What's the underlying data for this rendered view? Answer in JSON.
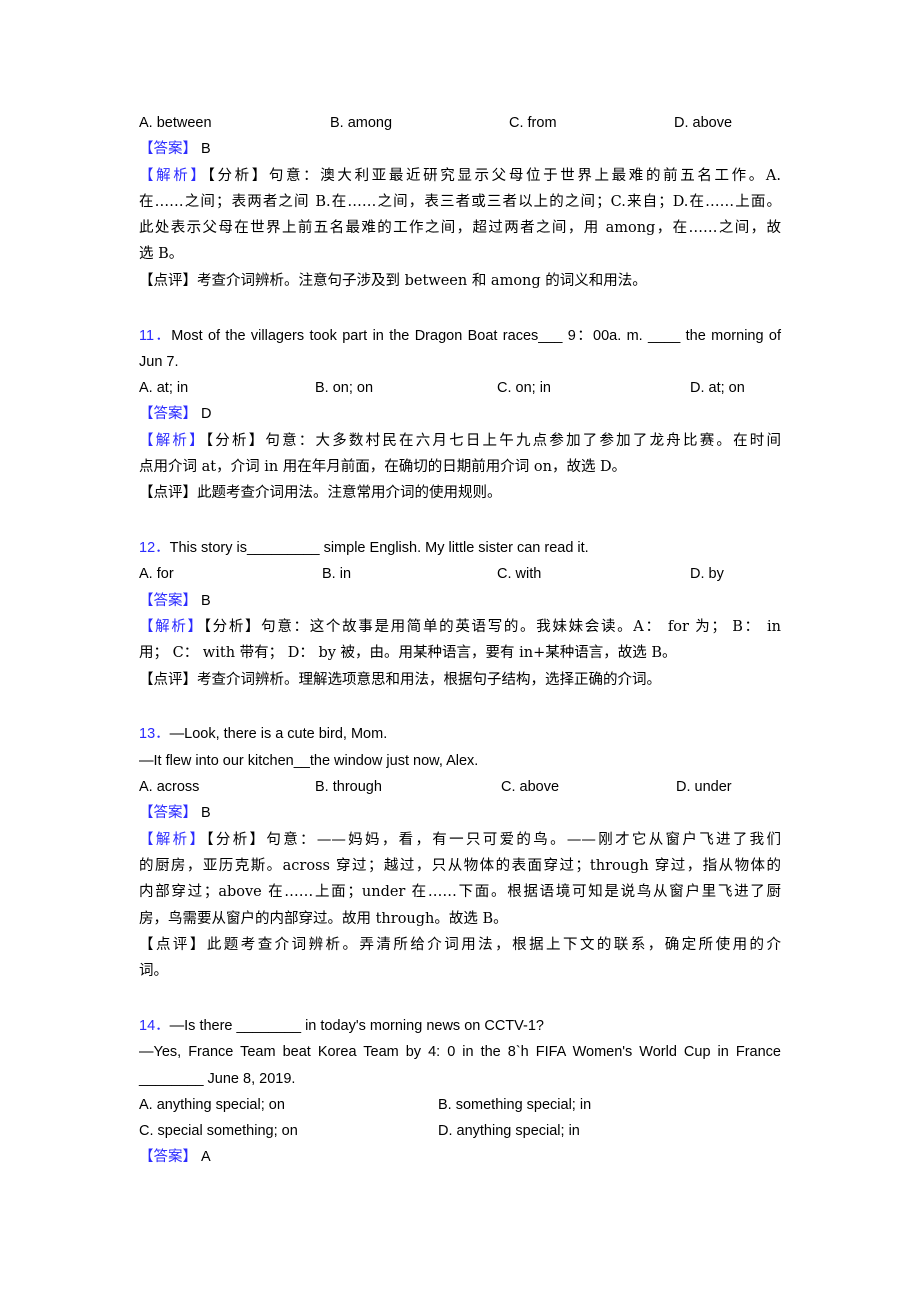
{
  "q10": {
    "options": [
      "A. between",
      "B. among",
      "C. from",
      "D. above"
    ],
    "answer_label": "【答案】",
    "answer": "B",
    "analysis_label": "【解析】",
    "analysis_lines": [
      "【分析】句意：澳大利亚最近研究显示父母位于世界上最难的前五名工作。A.",
      "在……之间；表两者之间 B.在……之间，表三者或三者以上的之间；C.来自；D.在……上面。",
      "此处表示父母在世界上前五名最难的工作之间，超过两者之间，用 among，在……之间，故",
      "选 B。"
    ],
    "comment": "【点评】考查介词辨析。注意句子涉及到 between 和 among 的词义和用法。"
  },
  "q11": {
    "number": "11．",
    "stem_lines": [
      "Most of the villagers took part in the Dragon Boat races___ 9：00a. m. ____ the morning of",
      "Jun 7."
    ],
    "options": [
      "A. at; in",
      "B. on; on",
      "C. on; in",
      "D. at; on"
    ],
    "answer_label": "【答案】",
    "answer": "D",
    "analysis_label": "【解析】",
    "analysis_lines": [
      "【分析】句意：大多数村民在六月七日上午九点参加了参加了龙舟比赛。在时间",
      "点用介词 at，介词 in 用在年月前面，在确切的日期前用介词 on，故选 D。"
    ],
    "comment": "【点评】此题考查介词用法。注意常用介词的使用规则。"
  },
  "q12": {
    "number": "12．",
    "stem_lines": [
      "This story is_________ simple English. My little sister can read it."
    ],
    "options": [
      "A. for",
      "B. in",
      "C. with",
      "D. by"
    ],
    "answer_label": "【答案】",
    "answer": "B",
    "analysis_label": "【解析】",
    "analysis_lines": [
      "【分析】句意：这个故事是用简单的英语写的。我妹妹会读。A： for 为； B： in",
      "用； C： with 带有； D： by 被，由。用某种语言，要有 in+某种语言，故选 B。"
    ],
    "comment": "【点评】考查介词辨析。理解选项意思和用法，根据句子结构，选择正确的介词。"
  },
  "q13": {
    "number": "13．",
    "stem_lines": [
      "—Look, there is a cute bird, Mom.",
      "—It flew into our kitchen__the window just now, Alex."
    ],
    "options": [
      "A. across",
      "B. through",
      "C. above",
      "D. under"
    ],
    "answer_label": "【答案】",
    "answer": "B",
    "analysis_label": "【解析】",
    "analysis_lines": [
      "【分析】句意：——妈妈，看，有一只可爱的鸟。——刚才它从窗户飞进了我们",
      "的厨房，亚历克斯。across 穿过；越过，只从物体的表面穿过；through 穿过，指从物体的",
      "内部穿过；above 在……上面；under 在……下面。根据语境可知是说鸟从窗户里飞进了厨",
      "房，鸟需要从窗户的内部穿过。故用 through。故选 B。"
    ],
    "comment_lines": [
      "【点评】此题考查介词辨析。弄清所给介词用法，根据上下文的联系，确定所使用的介",
      "词。"
    ]
  },
  "q14": {
    "number": "14．",
    "stem_lines": [
      "—Is there ________ in today's morning news on CCTV-1?",
      "—Yes, France Team beat Korea Team by 4: 0 in the 8`h FIFA Women's World Cup in France",
      "________ June 8, 2019."
    ],
    "options": [
      "A. anything special; on",
      "B. something special; in",
      "C. special something; on",
      "D. anything special; in"
    ],
    "answer_label": "【答案】",
    "answer": "A"
  },
  "colors": {
    "label_blue": "#2b2bff",
    "text": "#000000"
  }
}
